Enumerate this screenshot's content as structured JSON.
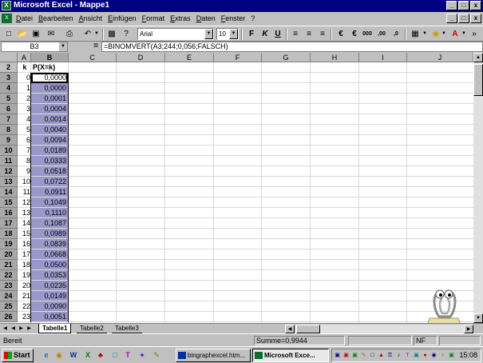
{
  "window": {
    "title": "Microsoft Excel - Mappe1",
    "app_icon": "excel-icon",
    "caption_buttons": [
      "_",
      "□",
      "x"
    ]
  },
  "menu": {
    "items": [
      "Datei",
      "Bearbeiten",
      "Ansicht",
      "Einfügen",
      "Format",
      "Extras",
      "Daten",
      "Fenster",
      "?"
    ]
  },
  "toolbar": {
    "font_name": "Arial",
    "font_size": "10",
    "bold": "F",
    "italic": "K",
    "underline": "U",
    "euro1": "€",
    "euro2": "€",
    "thousands": "000",
    "inc_dec": ",00",
    "dec_dec": ",0"
  },
  "formula_bar": {
    "name_box": "B3",
    "equals": "=",
    "formula": "=BINOMVERT(A3;244;0,056;FALSCH)"
  },
  "columns": [
    "A",
    "B",
    "C",
    "D",
    "E",
    "F",
    "G",
    "H",
    "I",
    "J"
  ],
  "rows": [
    "2",
    "3",
    "4",
    "5",
    "6",
    "7",
    "8",
    "9",
    "10",
    "11",
    "12",
    "13",
    "14",
    "15",
    "16",
    "17",
    "18",
    "19",
    "20",
    "21",
    "22",
    "23",
    "24",
    "25",
    "26"
  ],
  "sheet": {
    "header_a": "k",
    "header_b": "P(X=k)",
    "k_values": [
      "0",
      "1",
      "2",
      "3",
      "4",
      "5",
      "6",
      "7",
      "8",
      "9",
      "10",
      "11",
      "12",
      "13",
      "14",
      "15",
      "16",
      "17",
      "18",
      "19",
      "20",
      "21",
      "22",
      "23"
    ],
    "p_values": [
      "0,0000",
      "0,0000",
      "0,0001",
      "0,0004",
      "0,0014",
      "0,0040",
      "0,0094",
      "0,0189",
      "0,0333",
      "0,0518",
      "0,0722",
      "0,0911",
      "0,1049",
      "0,1110",
      "0,1087",
      "0,0989",
      "0,0839",
      "0,0668",
      "0,0500",
      "0,0353",
      "0,0235",
      "0,0149",
      "0,0090",
      "0,0051"
    ]
  },
  "tabs": [
    "Tabelle1",
    "Tabelle2",
    "Tabelle3"
  ],
  "status": {
    "ready": "Bereit",
    "sum": "Summe=0,9944",
    "nf": "NF"
  },
  "taskbar": {
    "start": "Start",
    "tasks": [
      "bingraphexcel.htm...",
      "Microsoft Exce..."
    ],
    "clock": "15:08"
  },
  "colors": {
    "selection": "#9a98c8",
    "title_bg": "#000080",
    "chrome": "#c0c0c0"
  }
}
